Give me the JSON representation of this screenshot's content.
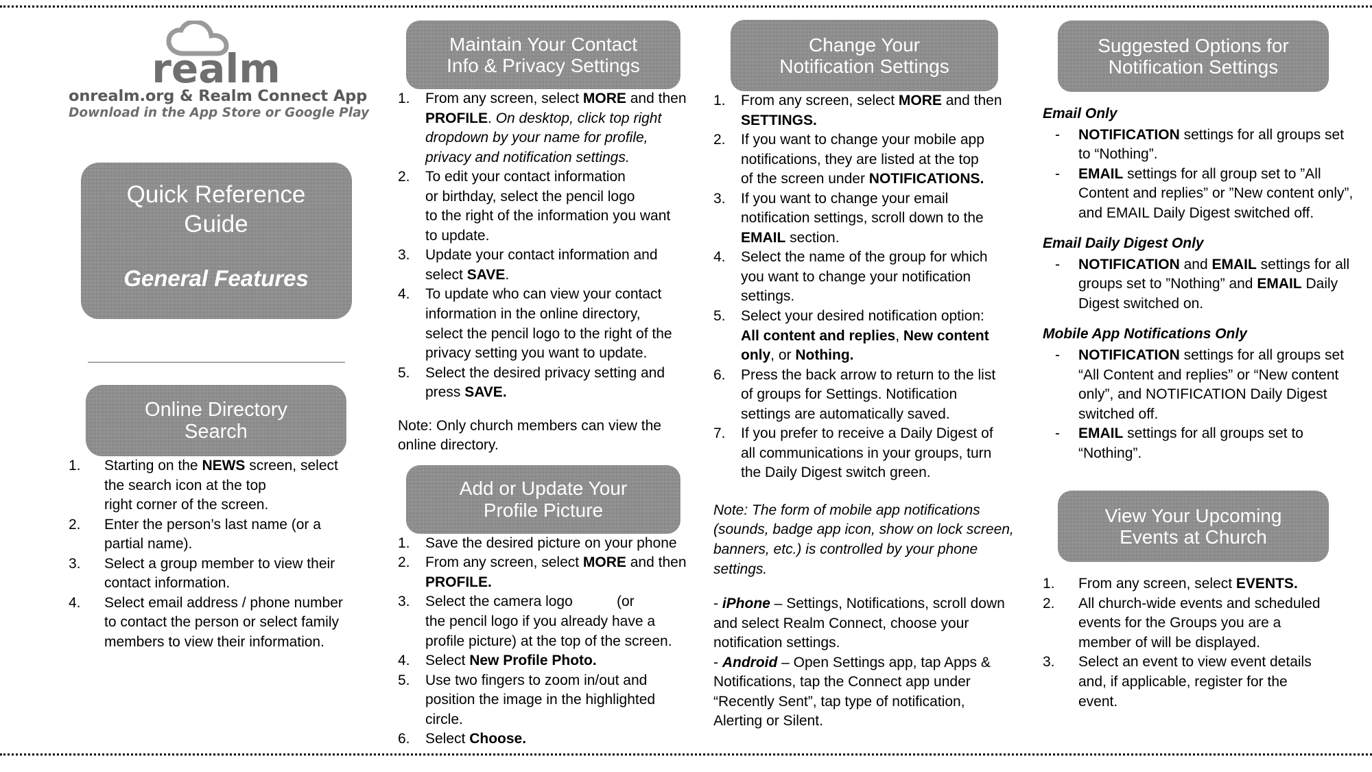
{
  "document": {
    "title": "Quick Reference Guide",
    "subtitle": "General Features"
  },
  "brand": {
    "wordmark": "realm",
    "logo_icon": "cloud-icon",
    "line1": "onrealm.org & Realm Connect App",
    "line2": "Download in the App Store or Google Play"
  },
  "sections": {
    "online_directory": {
      "heading_line1": "Online Directory",
      "heading_line2": "Search",
      "steps": [
        {
          "num": "1.",
          "html": "Starting on the <b>NEWS</b> screen, select<br>the search icon at the top<br>right corner of the screen."
        },
        {
          "num": "2.",
          "html": "Enter the person’s last name (or a<br>partial name)."
        },
        {
          "num": "3.",
          "html": "Select a group member to view their<br>contact information."
        },
        {
          "num": "4.",
          "html": "Select email address / phone number<br>to contact the person or select family<br>members to view their information."
        }
      ]
    },
    "maintain_contact": {
      "heading_line1": "Maintain Your Contact",
      "heading_line2": "Info & Privacy Settings",
      "steps": [
        {
          "num": "1.",
          "html": "From any screen, select <b>MORE</b> and then<br><b>PROFILE</b>. <i>On desktop, click top right<br>dropdown by your name for profile,<br>privacy and notification settings.</i>"
        },
        {
          "num": "2.",
          "html": "To edit your contact information<br>or birthday, select the pencil logo<br>to the right of the information you want<br>to update."
        },
        {
          "num": "3.",
          "html": "Update your contact information and<br>select <b>SAVE</b>."
        },
        {
          "num": "4.",
          "html": "To update who can view your contact<br>information in the online directory,<br>select the pencil logo to the right of the<br>privacy setting you want to update."
        },
        {
          "num": "5.",
          "html": "Select the desired privacy setting and<br>press <b>SAVE.</b>"
        }
      ],
      "note": "Note:  Only church members can view the online directory."
    },
    "profile_picture": {
      "heading_line1": "Add or Update Your",
      "heading_line2": "Profile Picture",
      "steps": [
        {
          "num": "1.",
          "html": "Save the desired picture on your phone"
        },
        {
          "num": "2.",
          "html": "From any screen, select <b>MORE</b> and then<br><b>PROFILE.</b>"
        },
        {
          "num": "3.",
          "html": "Select the camera logo&nbsp;&nbsp;&nbsp;&nbsp;&nbsp;&nbsp;&nbsp;&nbsp;&nbsp;&nbsp;&nbsp;(or<br>the pencil logo if you already have a<br>profile picture) at the top of the screen."
        },
        {
          "num": "4.",
          "html": "Select <b>New Profile Photo.</b>"
        },
        {
          "num": "5.",
          "html": "Use two fingers to zoom in/out and<br>position the image in the highlighted<br>circle."
        },
        {
          "num": "6.",
          "html": "Select <b>Choose.</b>"
        }
      ]
    },
    "change_notifications": {
      "heading_line1": "Change Your",
      "heading_line2": "Notification Settings",
      "steps": [
        {
          "num": "1.",
          "html": "From any screen, select <b>MORE</b> and then<br><b>SETTINGS.</b>"
        },
        {
          "num": "2.",
          "html": "If you want to change your mobile app<br>notifications, they are listed at the top<br>of the screen under <b>NOTIFICATIONS.</b>"
        },
        {
          "num": "3.",
          "html": "If you want to change your email<br>notification settings, scroll down to the<br><b>EMAIL</b> section."
        },
        {
          "num": "4.",
          "html": "Select the name of the group for which<br>you want to change your notification<br>settings."
        },
        {
          "num": "5.",
          "html": "Select your desired notification option:<br><b>All content and replies</b>, <b>New content<br>only</b>, or <b>Nothing.</b>"
        },
        {
          "num": "6.",
          "html": "Press the back arrow to return to the list<br>of groups for Settings.  Notification<br>settings are automatically saved."
        },
        {
          "num": "7.",
          "html": "If you prefer to receive a Daily Digest of<br>all communications in your groups, turn<br>the Daily Digest switch green."
        }
      ],
      "note": "Note:  The form of mobile app notifications (sounds, badge app icon, show on lock screen, banners, etc.) is controlled by your phone settings.",
      "platforms": [
        {
          "label": "iPhone",
          "dash": "-",
          "sep": "–",
          "text": " Settings, Notifications, scroll down and select Realm Connect, choose your notification settings."
        },
        {
          "label": "Android",
          "dash": "-",
          "sep": "–",
          "text": " Open Settings app, tap Apps & Notifications, tap the Connect app under “Recently Sent”, tap type of notification, Alerting or Silent."
        }
      ]
    },
    "suggested_options": {
      "heading_line1": "Suggested Options for",
      "heading_line2": "Notification Settings",
      "groups": [
        {
          "title": "Email Only",
          "items": [
            "<b>NOTIFICATION</b> settings for all groups set to “Nothing”.",
            "<b>EMAIL</b> settings for all group set to ”All Content and replies” or ”New content only”, and EMAIL Daily Digest switched off."
          ]
        },
        {
          "title": "Email Daily Digest Only",
          "items": [
            "<b>NOTIFICATION</b> and <b>EMAIL</b> settings for all groups set to ”Nothing” and <b>EMAIL</b> Daily Digest switched on."
          ]
        },
        {
          "title": "Mobile App Notifications Only",
          "items": [
            "<b>NOTIFICATION</b> settings for all groups set “All Content and replies” or “New content only”,  and NOTIFICATION Daily Digest switched off.",
            "<b>EMAIL</b> settings for all groups set to “Nothing”."
          ]
        }
      ]
    },
    "upcoming_events": {
      "heading_line1": "View Your Upcoming",
      "heading_line2": "Events at Church",
      "steps": [
        {
          "num": "1.",
          "html": "From any screen, select <b>EVENTS.</b>"
        },
        {
          "num": "2.",
          "html": "All church-wide events and scheduled<br>events for the Groups you are a<br>member of will be displayed."
        },
        {
          "num": "3.",
          "html": "Select an event to view event details<br>and, if applicable, register for the<br>event."
        }
      ]
    }
  },
  "colors": {
    "box_gray": "#8c8c8c",
    "logo_gray": "#5a5a5a",
    "divider_gray": "#a9a9a9",
    "text": "#000000"
  }
}
